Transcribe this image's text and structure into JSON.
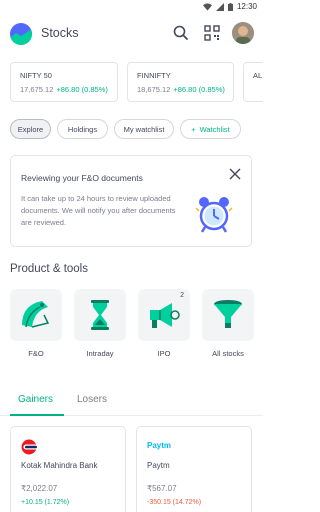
{
  "status_bar": {
    "time": "12:30"
  },
  "header": {
    "title": "Stocks"
  },
  "indices": [
    {
      "name": "NIFTY 50",
      "value": "17,675.12",
      "change": "+86.80 (0.85%)"
    },
    {
      "name": "FINNIFTY",
      "value": "18,675.12",
      "change": "+86.80 (0.85%)"
    },
    {
      "name": "AL",
      "value": "",
      "change": ""
    }
  ],
  "chips": [
    {
      "label": "Explore",
      "active": true
    },
    {
      "label": "Holdings"
    },
    {
      "label": "My watchlist"
    },
    {
      "label": "Watchlist",
      "prefix": "+"
    }
  ],
  "banner": {
    "title": "Reviewing your F&O documents",
    "body": "It can take up to 24 hours to review uploaded documents. We will notify you after documents are reviewed."
  },
  "products": {
    "title": "Product & tools",
    "items": [
      {
        "label": "F&O",
        "icon": "fno-icon"
      },
      {
        "label": "Intraday",
        "icon": "hourglass-icon"
      },
      {
        "label": "IPO",
        "icon": "ipo-megaphone-icon",
        "badge": "2"
      },
      {
        "label": "All stocks",
        "icon": "funnel-icon"
      }
    ]
  },
  "tabs": {
    "gainers": "Gainers",
    "losers": "Losers"
  },
  "stocks": [
    {
      "logo_text": "",
      "name": "Kotak Mahindra Bank",
      "price": "₹2,022.07",
      "change": "+10.15 (1.72%)",
      "direction": "up"
    },
    {
      "logo_text": "Paytm",
      "name": "Paytm",
      "price": "₹567.07",
      "change": "-350.15 (14.72%)",
      "direction": "down"
    }
  ],
  "colors": {
    "accent": "#00b386",
    "negative": "#eb5b3c",
    "text": "#44475b",
    "muted": "#7c7e8c"
  }
}
